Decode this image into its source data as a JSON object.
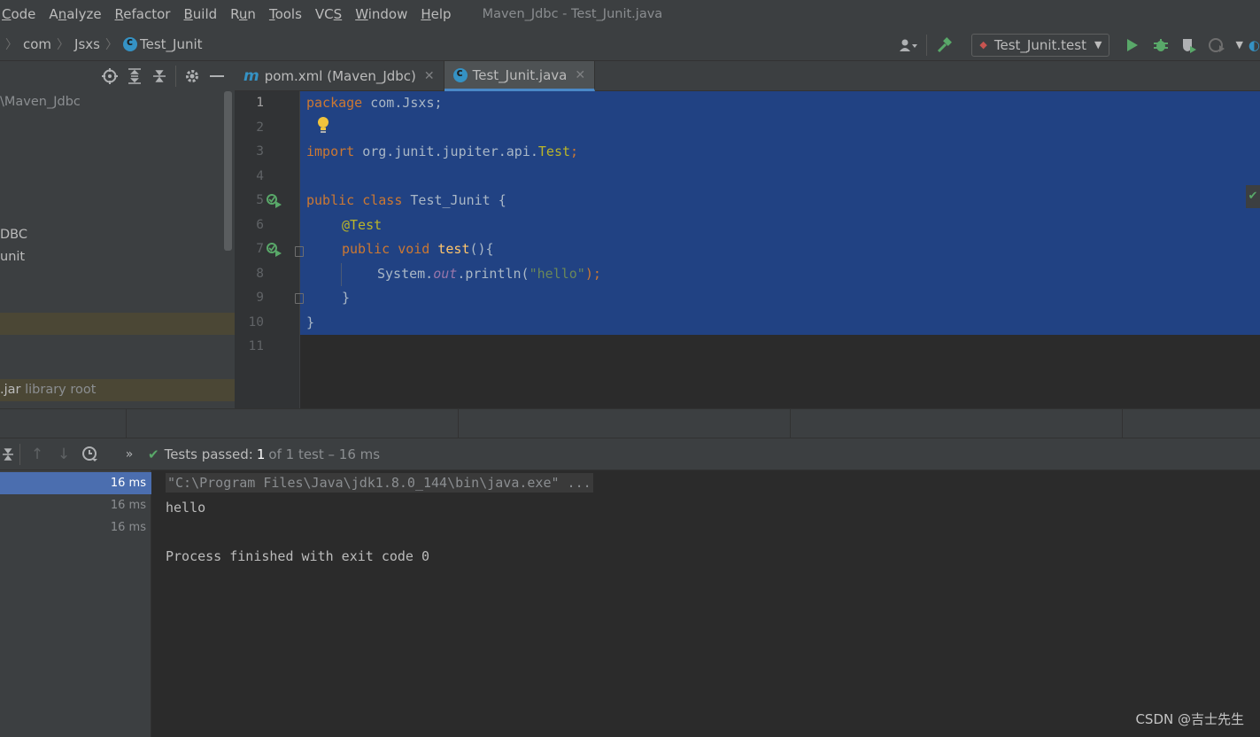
{
  "menu": {
    "items": [
      {
        "pre": "",
        "u": "C",
        "post": "ode"
      },
      {
        "pre": "A",
        "u": "n",
        "post": "alyze"
      },
      {
        "pre": "",
        "u": "R",
        "post": "efactor"
      },
      {
        "pre": "",
        "u": "B",
        "post": "uild"
      },
      {
        "pre": "R",
        "u": "u",
        "post": "n"
      },
      {
        "pre": "",
        "u": "T",
        "post": "ools"
      },
      {
        "pre": "VC",
        "u": "S",
        "post": ""
      },
      {
        "pre": "",
        "u": "W",
        "post": "indow"
      },
      {
        "pre": "",
        "u": "H",
        "post": "elp"
      }
    ],
    "window_title": "Maven_Jdbc - Test_Junit.java"
  },
  "breadcrumb": [
    "com",
    "Jsxs",
    "Test_Junit"
  ],
  "run_config": {
    "label": "Test_Junit.test"
  },
  "icons": {
    "user": "user-icon",
    "hammer": "hammer-icon",
    "run": "run-icon",
    "debug": "debug-icon",
    "coverage": "coverage-icon",
    "profile": "profile-icon",
    "locate": "locate-icon",
    "expand": "expand-all-icon",
    "collapse": "collapse-all-icon",
    "settings": "gear-icon",
    "hide": "minimize-icon",
    "bulb": "lightbulb-icon",
    "check": "check-icon"
  },
  "project": {
    "rows": [
      {
        "text": "\\Maven_Jdbc",
        "extra": "",
        "hl": false
      },
      {
        "text": "DBC",
        "extra": "",
        "hl": false
      },
      {
        "text": "unit",
        "extra": "",
        "hl": false
      },
      {
        "text": "",
        "extra": "",
        "hl": true
      },
      {
        "text": ".jar",
        "extra": "library root",
        "hl": true
      }
    ]
  },
  "tabs": [
    {
      "label": "pom.xml (Maven_Jdbc)",
      "type": "maven",
      "active": false
    },
    {
      "label": "Test_Junit.java",
      "type": "class",
      "active": true
    }
  ],
  "editor": {
    "line_numbers": [
      "1",
      "2",
      "3",
      "4",
      "5",
      "6",
      "7",
      "8",
      "9",
      "10",
      "11"
    ],
    "lines": {
      "l1_kw": "package",
      "l1_rest": " com.Jsxs;",
      "l3_kw": "import",
      "l3_rest": " org.junit.jupiter.api.",
      "l3_cls": "Test",
      "l3_semi": ";",
      "l5_kw": "public class",
      "l5_rest": " Test_Junit {",
      "l6_ann": "@Test",
      "l7_kw": "public void",
      "l7_fn": " test",
      "l7_rest": "(){",
      "l8_a": "System.",
      "l8_fld": "out",
      "l8_b": ".println(",
      "l8_str": "\"hello\"",
      "l8_c": ");",
      "l9": "}",
      "l10": "}"
    }
  },
  "test_toolbar": {
    "status_label": "Tests passed:",
    "passed_count": "1",
    "status_rest": "of 1 test – 16 ms"
  },
  "test_tree": {
    "rows": [
      "16 ms",
      "16 ms",
      "16 ms"
    ]
  },
  "console": {
    "cmd": "\"C:\\Program Files\\Java\\jdk1.8.0_144\\bin\\java.exe\" ...",
    "out": "hello",
    "exit": "Process finished with exit code 0"
  },
  "watermark": "CSDN @吉士先生"
}
